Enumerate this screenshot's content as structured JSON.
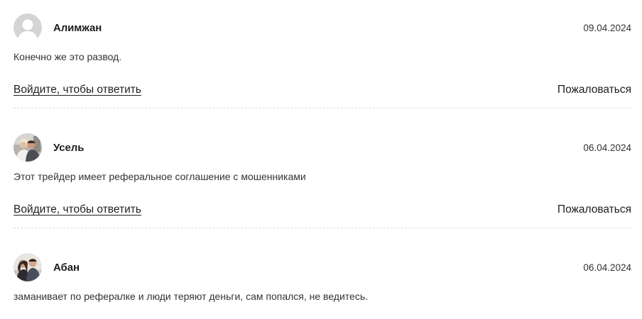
{
  "comments": [
    {
      "author": "Алимжан",
      "date": "09.04.2024",
      "text": "Конечно же это развод.",
      "reply_label": "Войдите, чтобы ответить",
      "report_label": "Пожаловаться",
      "avatar": "default-user-avatar"
    },
    {
      "author": "Усель",
      "date": "06.04.2024",
      "text": "Этот трейдер имеет реферальное соглашение с мошенниками",
      "reply_label": "Войдите, чтобы ответить",
      "report_label": "Пожаловаться",
      "avatar": "photo-avatar"
    },
    {
      "author": "Абан",
      "date": "06.04.2024",
      "text": "заманивает по рефералке и люди теряют деньги, сам попался, не ведитесь.",
      "avatar": "photo-avatar"
    }
  ],
  "colors": {
    "text": "#333333",
    "author": "#1e1e1e",
    "divider": "#d9d9d9",
    "default_avatar_bg": "#d4d4d4"
  }
}
